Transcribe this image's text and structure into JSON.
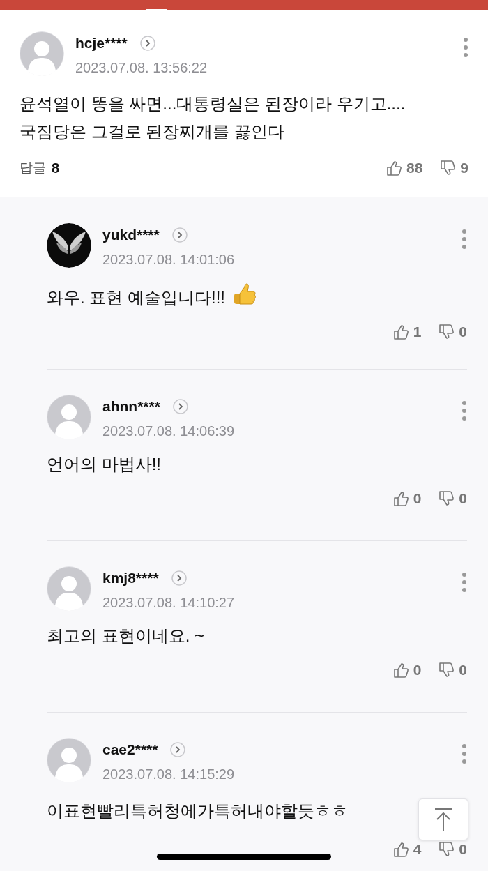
{
  "comment": {
    "author": "hcje****",
    "time": "2023.07.08. 13:56:22",
    "text": "윤석열이 똥을 싸면...대통령실은 된장이라 우기고....국짐당은 그걸로 된장찌개를 끓인다",
    "reply_label": "답글",
    "reply_count": "8",
    "likes": "88",
    "dislikes": "9"
  },
  "replies": [
    {
      "author": "yukd****",
      "time": "2023.07.08. 14:01:06",
      "text": "와우. 표현 예술입니다!!!",
      "thumbs_emoji": true,
      "likes": "1",
      "dislikes": "0"
    },
    {
      "author": "ahnn****",
      "avatar": {
        "kind": "default"
      },
      "time": "2023.07.08. 14:06:39",
      "text": "언어의 마법사!!",
      "thumbs_emoji": false,
      "likes": "0",
      "dislikes": "0"
    },
    {
      "author": "kmj8****",
      "avatar": {
        "kind": "default"
      },
      "time": "2023.07.08. 14:10:27",
      "text": "최고의 표현이네요. ~",
      "thumbs_emoji": false,
      "likes": "0",
      "dislikes": "0"
    },
    {
      "author": "cae2****",
      "avatar": {
        "kind": "default"
      },
      "time": "2023.07.08. 14:15:29",
      "text": "이표현빨리특허청에가특허내야할듯ㅎㅎ",
      "thumbs_emoji": false,
      "likes": "4",
      "dislikes": "0"
    }
  ]
}
